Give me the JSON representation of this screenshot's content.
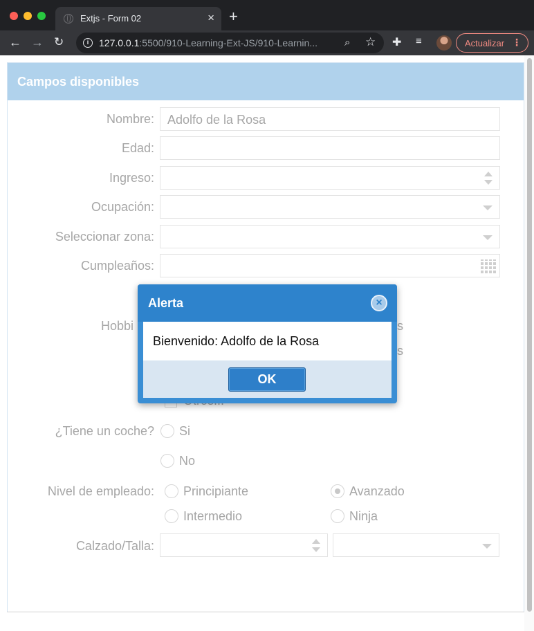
{
  "browser": {
    "tab_title": "Extjs - Form 02",
    "tab_close": "×",
    "new_tab": "+",
    "url_host": "127.0.0.1",
    "url_rest": ":5500/910-Learning-Ext-JS/910-Learnin...",
    "update_label": "Actualizar",
    "menu_dots": "⋮",
    "back": "←",
    "forward": "→",
    "reload": "↻",
    "info": "i",
    "zoom": "⌕",
    "star": "☆",
    "extensions": "✚",
    "media": "≡"
  },
  "panel": {
    "title": "Campos disponibles"
  },
  "form": {
    "nombre_label": "Nombre:",
    "nombre_value": "Adolfo de la Rosa",
    "edad_label": "Edad:",
    "ingreso_label": "Ingreso:",
    "ocupacion_label": "Ocupación:",
    "zona_label": "Seleccionar zona:",
    "cumple_label": "Cumpleaños:",
    "hobbies_label_partial": "Hobbi",
    "hobby_partial_1": "s",
    "hobby_partial_2": "s",
    "otros_partial": "Otros...",
    "coche_label": "¿Tiene un coche?",
    "coche_si": "Si",
    "coche_no": "No",
    "nivel_label": "Nivel de empleado:",
    "nivel_options": [
      "Principiante",
      "Intermedio",
      "Avanzado",
      "Ninja"
    ],
    "nivel_selected": "Avanzado",
    "calzado_label": "Calzado/Talla:"
  },
  "modal": {
    "title": "Alerta",
    "close": "×",
    "message": "Bienvenido: Adolfo de la Rosa",
    "ok_label": "OK"
  }
}
